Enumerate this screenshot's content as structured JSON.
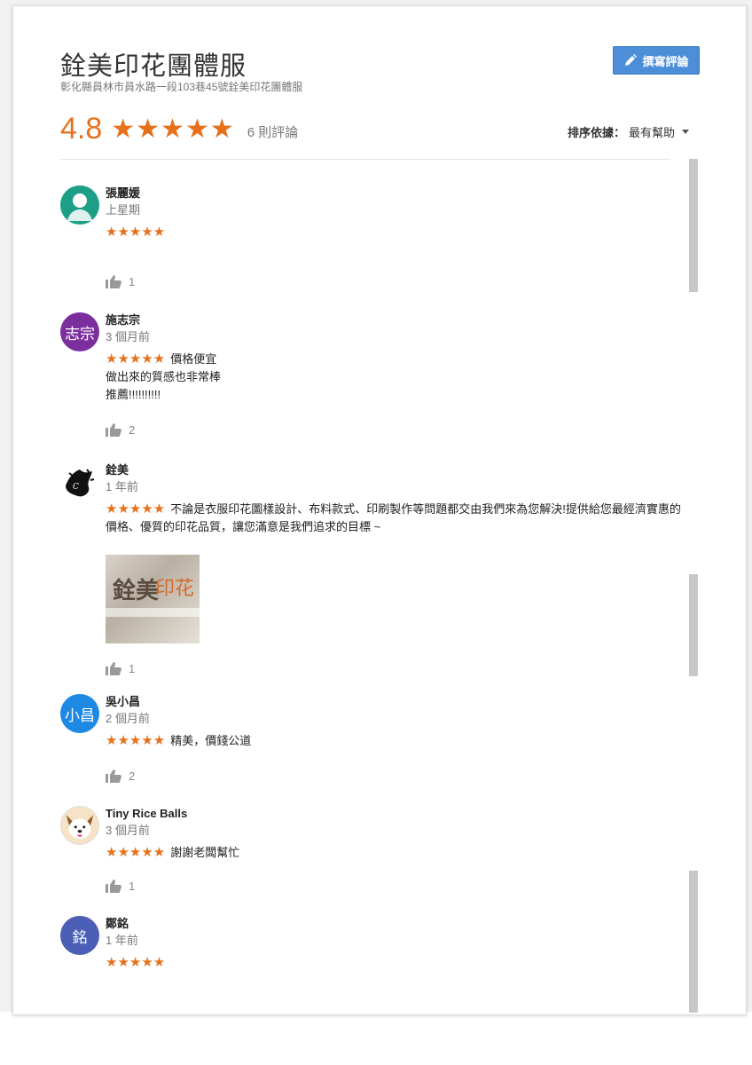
{
  "place": {
    "title": "銓美印花團體服",
    "address": "彰化縣員林市員水路一段103巷45號銓美印花團體服"
  },
  "write_review": {
    "label": "撰寫評論",
    "icon": "pencil-icon"
  },
  "summary": {
    "average": "4.8",
    "stars": "★★★★★",
    "count_label": "6 則評論"
  },
  "sort": {
    "label": "排序依據：",
    "value": "最有幫助"
  },
  "colors": {
    "accent": "#e7711b",
    "button": "#4d8ed8"
  },
  "reviews": [
    {
      "name": "張麗媛",
      "time": "上星期",
      "stars": "★★★★★",
      "text": "",
      "extra": "",
      "likes": "1",
      "avatar": {
        "type": "default-person",
        "color": "#1c9e87",
        "initials": ""
      }
    },
    {
      "name": "施志宗",
      "time": "3 個月前",
      "stars": "★★★★★",
      "text": "價格便宜",
      "extra": "做出來的質感也非常棒\n推薦!!!!!!!!!!",
      "likes": "2",
      "avatar": {
        "type": "initials",
        "color": "#7b2f9e",
        "initials": "志宗"
      }
    },
    {
      "name": "銓美",
      "time": "1 年前",
      "stars": "★★★★★",
      "text": "不論是衣服印花圖樣設計、布料款式、印刷製作等問題都交由我們來為您解決!提供給您最經濟實惠的價格、優質的印花品質，讓您滿意是我們追求的目標 ~",
      "extra": "",
      "likes": "1",
      "avatar": {
        "type": "logo",
        "color": "#000000",
        "initials": ""
      },
      "photo": {
        "brand": "銓美",
        "accent": "印花"
      }
    },
    {
      "name": "吳小昌",
      "time": "2 個月前",
      "stars": "★★★★★",
      "text": "精美，價錢公道",
      "extra": "",
      "likes": "2",
      "avatar": {
        "type": "initials",
        "color": "#1e88e5",
        "initials": "小昌"
      }
    },
    {
      "name": "Tiny Rice Balls",
      "time": "3 個月前",
      "stars": "★★★★★",
      "text": "謝謝老闆幫忙",
      "extra": "",
      "likes": "1",
      "avatar": {
        "type": "dog-photo",
        "color": "#f6e2c4",
        "initials": ""
      }
    },
    {
      "name": "鄭銘",
      "time": "1 年前",
      "stars": "★★★★★",
      "text": "",
      "extra": "",
      "likes": "",
      "avatar": {
        "type": "initials",
        "color": "#4a5fb5",
        "initials": "銘"
      }
    }
  ]
}
